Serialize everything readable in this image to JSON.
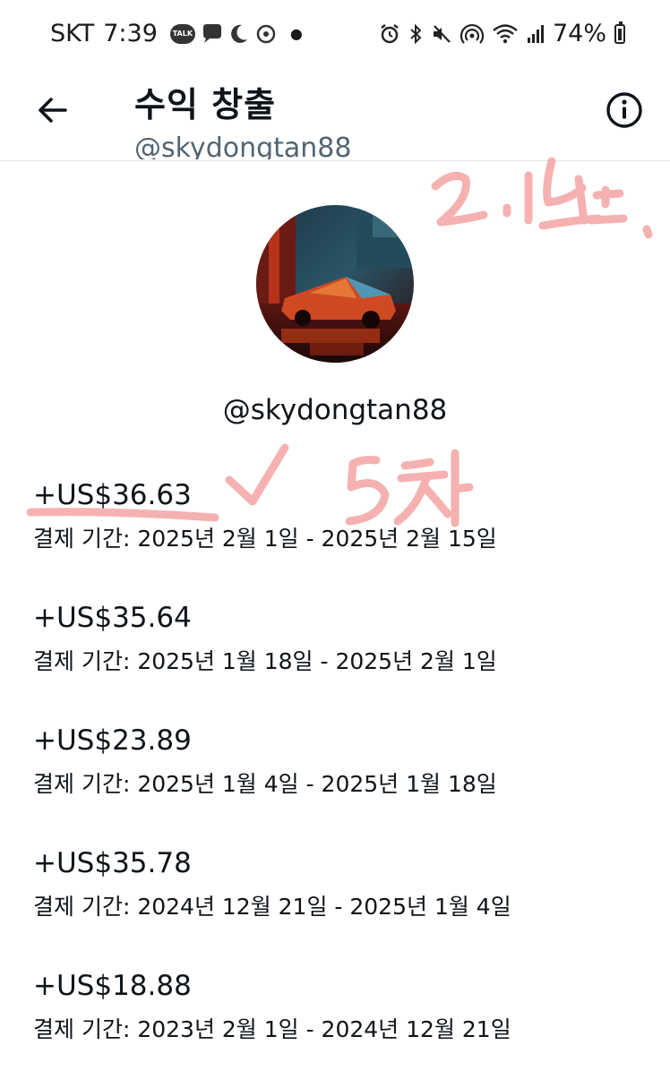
{
  "status_bar": {
    "carrier": "SKT",
    "time": "7:39",
    "talk_badge": "TALK",
    "battery": "74%"
  },
  "header": {
    "title": "수익 창출",
    "subtitle": "@skydongtan88"
  },
  "profile": {
    "handle": "@skydongtan88"
  },
  "earnings": [
    {
      "amount": "+US$36.63",
      "period": "결제 기간: 2025년 2월 1일 - 2025년 2월 15일"
    },
    {
      "amount": "+US$35.64",
      "period": "결제 기간: 2025년 1월 18일 - 2025년 2월 1일"
    },
    {
      "amount": "+US$23.89",
      "period": "결제 기간: 2025년 1월 4일 - 2025년 1월 18일"
    },
    {
      "amount": "+US$35.78",
      "period": "결제 기간: 2024년 12월 21일 - 2025년 1월 4일"
    },
    {
      "amount": "+US$18.88",
      "period": "결제 기간: 2023년 2월 1일 - 2024년 12월 21일"
    }
  ],
  "colors": {
    "text": "#0f1419",
    "secondary": "#536471",
    "annotation": "#f19a9a"
  }
}
